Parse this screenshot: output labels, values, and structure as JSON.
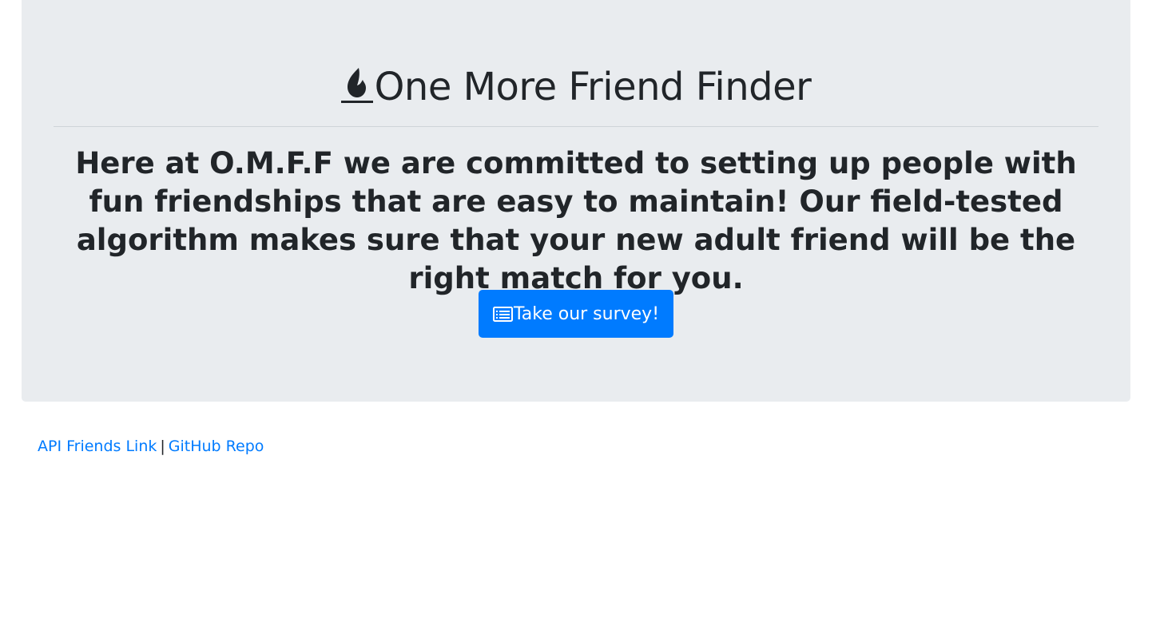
{
  "header": {
    "title": "One More Friend Finder",
    "title_icon": "fire-icon"
  },
  "intro": {
    "text": "Here at O.M.F.F we are committed to setting up people with fun friendships that are easy to maintain! Our field-tested algorithm makes sure that your new adult friend will be the right match for you."
  },
  "survey_button": {
    "label": "Take our survey!",
    "icon": "list-icon"
  },
  "footer": {
    "api_link": "API Friends Link",
    "separator": "|",
    "repo_link": "GitHub Repo"
  },
  "colors": {
    "jumbotron_bg": "#e9ecef",
    "primary": "#007bff",
    "text": "#212529",
    "link": "#007bff"
  }
}
